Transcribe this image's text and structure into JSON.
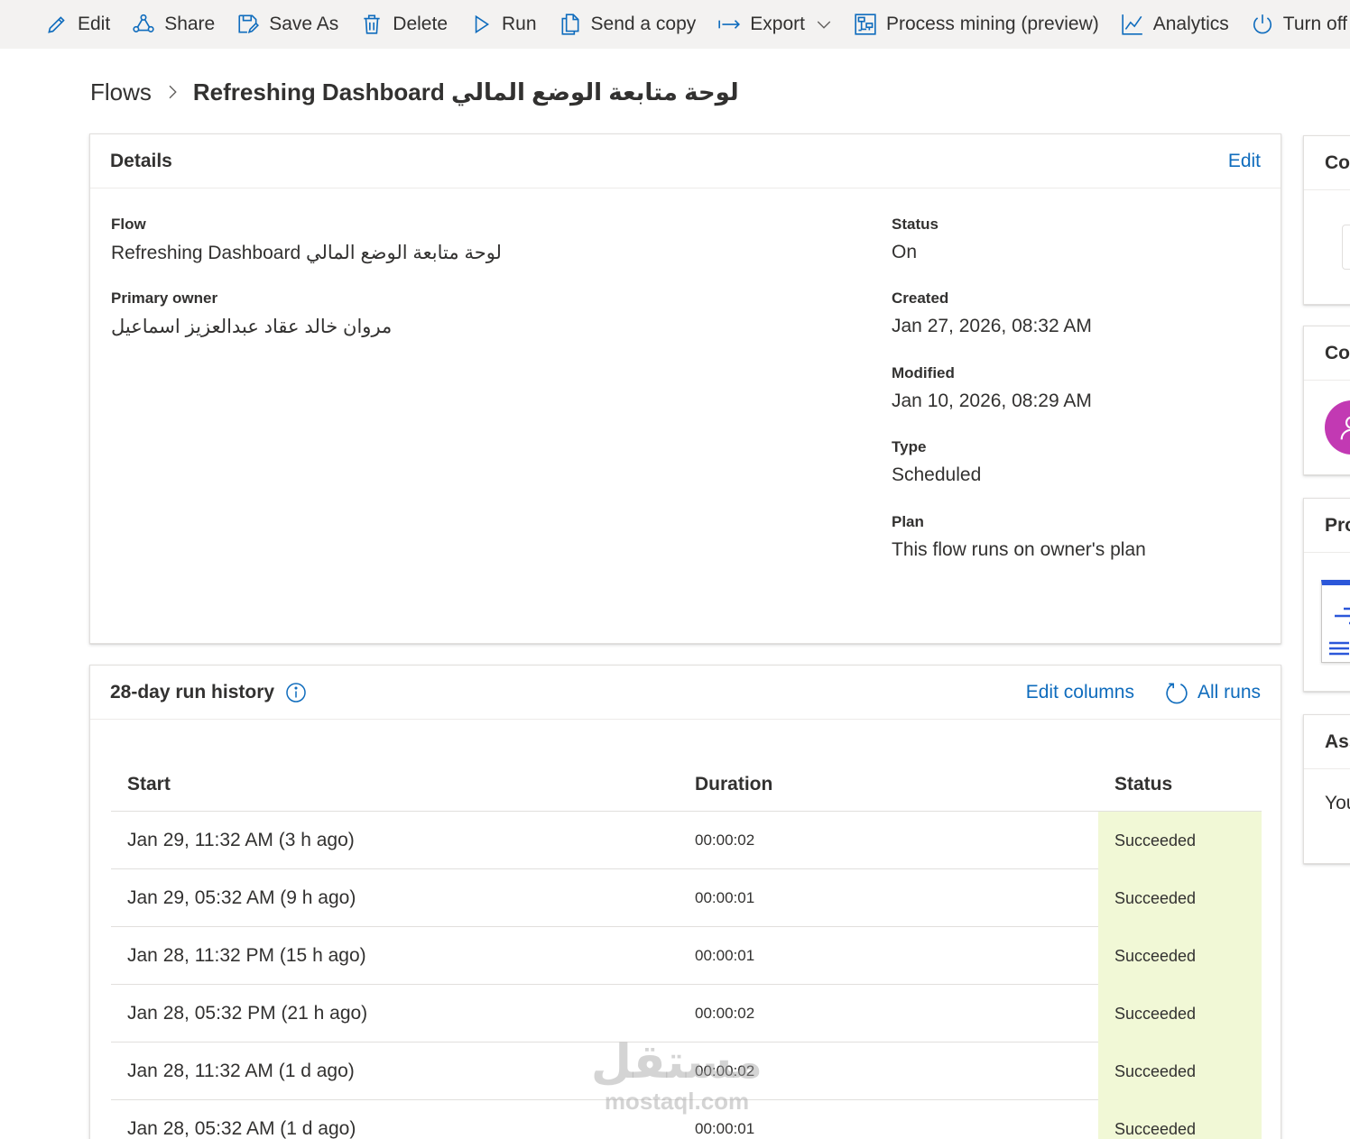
{
  "commandbar": {
    "edit": "Edit",
    "share": "Share",
    "save_as": "Save As",
    "delete": "Delete",
    "run": "Run",
    "send_copy": "Send a copy",
    "export": "Export",
    "process_mining": "Process mining (preview)",
    "analytics": "Analytics",
    "turn_off": "Turn off"
  },
  "breadcrumb": {
    "root": "Flows",
    "current": "Refreshing Dashboard لوحة متابعة الوضع المالي"
  },
  "details": {
    "title": "Details",
    "edit_link": "Edit",
    "flow_label": "Flow",
    "flow_value": "Refreshing Dashboard لوحة متابعة الوضع المالي",
    "owner_label": "Primary owner",
    "owner_value": "مروان خالد عقاد عبدالعزيز اسماعيل",
    "status_label": "Status",
    "status_value": "On",
    "created_label": "Created",
    "created_value": "Jan 27, 2026, 08:32 AM",
    "modified_label": "Modified",
    "modified_value": "Jan 10, 2026, 08:29 AM",
    "type_label": "Type",
    "type_value": "Scheduled",
    "plan_label": "Plan",
    "plan_value": "This flow runs on owner's plan"
  },
  "history": {
    "title": "28-day run history",
    "edit_columns": "Edit columns",
    "all_runs": "All runs",
    "columns": {
      "start": "Start",
      "duration": "Duration",
      "status": "Status"
    },
    "rows": [
      {
        "start": "Jan 29, 11:32 AM (3 h ago)",
        "duration": "00:00:02",
        "status": "Succeeded"
      },
      {
        "start": "Jan 29, 05:32 AM (9 h ago)",
        "duration": "00:00:01",
        "status": "Succeeded"
      },
      {
        "start": "Jan 28, 11:32 PM (15 h ago)",
        "duration": "00:00:01",
        "status": "Succeeded"
      },
      {
        "start": "Jan 28, 05:32 PM (21 h ago)",
        "duration": "00:00:02",
        "status": "Succeeded"
      },
      {
        "start": "Jan 28, 11:32 AM (1 d ago)",
        "duration": "00:00:02",
        "status": "Succeeded"
      },
      {
        "start": "Jan 28, 05:32 AM (1 d ago)",
        "duration": "00:00:01",
        "status": "Succeeded"
      }
    ]
  },
  "side": {
    "card1_title": "Con",
    "card2_title": "Co",
    "card3_title": "Pro",
    "card4_title": "Ass",
    "card4_text": "You"
  },
  "watermark": {
    "arabic": "مستقل",
    "latin": "mostaql.com"
  },
  "colors": {
    "accent": "#0f6cbd",
    "commandbar_bg": "#f3f2f1",
    "success_bg": "#f1f8d6",
    "avatar": "#c239b3"
  }
}
